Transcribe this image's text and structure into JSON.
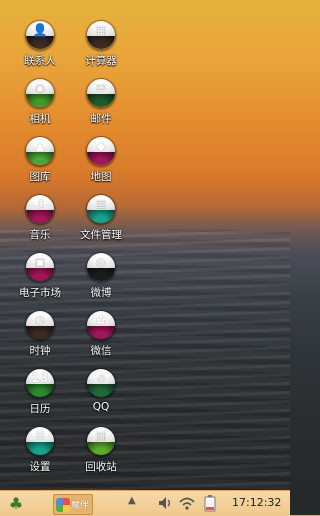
{
  "desktop": {
    "icons": [
      {
        "label": "联系人",
        "glyph": "👤",
        "color": "#3b2a22"
      },
      {
        "label": "计算器",
        "glyph": "▦",
        "color": "#3b2a22"
      },
      {
        "label": "相机",
        "glyph": "◉",
        "color": "#3e9a2a"
      },
      {
        "label": "邮件",
        "glyph": "✉",
        "color": "#1f5a2a"
      },
      {
        "label": "图库",
        "glyph": "▲",
        "color": "#4aa63a"
      },
      {
        "label": "地图",
        "glyph": "◆",
        "color": "#a0165a"
      },
      {
        "label": "音乐",
        "glyph": "♫",
        "color": "#a0165a"
      },
      {
        "label": "文件管理",
        "glyph": "▤",
        "color": "#17a08a"
      },
      {
        "label": "电子市场",
        "glyph": "▣",
        "color": "#a0165a"
      },
      {
        "label": "微博",
        "glyph": "◎",
        "color": "#1c1c1c"
      },
      {
        "label": "时钟",
        "glyph": "◷",
        "color": "#3b2a22"
      },
      {
        "label": "微信",
        "glyph": "✿",
        "color": "#a0165a"
      },
      {
        "label": "日历",
        "glyph": "23",
        "color": "#2a8a2a"
      },
      {
        "label": "QQ",
        "glyph": "☃",
        "color": "#1f6a3a"
      },
      {
        "label": "设置",
        "glyph": "⚙",
        "color": "#17a08a"
      },
      {
        "label": "回收站",
        "glyph": "▥",
        "color": "#5aaa2a"
      }
    ]
  },
  "taskbar": {
    "start_icon": "clover-icon",
    "task_label": "魔伴",
    "tray_arrow": "▲",
    "clock": "17:12:32"
  }
}
